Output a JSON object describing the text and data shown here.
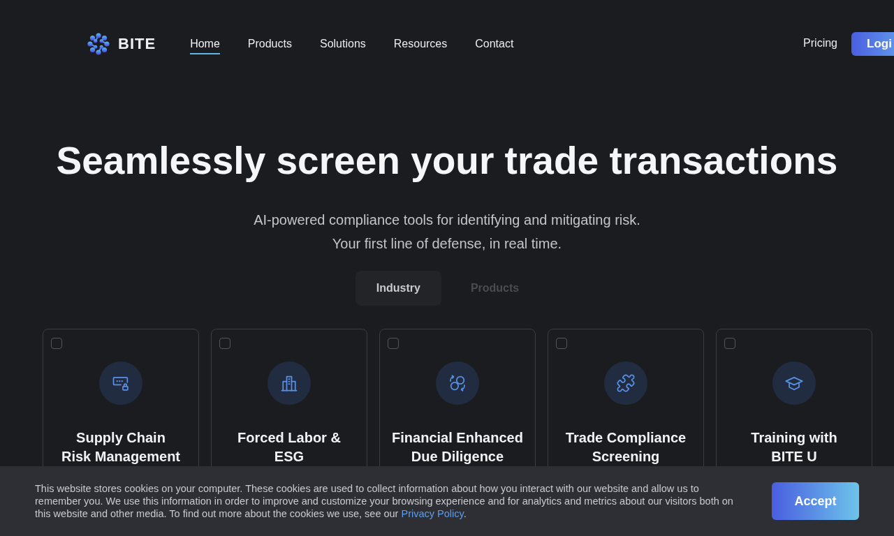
{
  "header": {
    "brand": "BITE",
    "nav": [
      {
        "label": "Home",
        "selected": true
      },
      {
        "label": "Products",
        "selected": false
      },
      {
        "label": "Solutions",
        "selected": false
      },
      {
        "label": "Resources",
        "selected": false
      },
      {
        "label": "Contact",
        "selected": false
      }
    ],
    "pricing_link": "Pricing",
    "login_button": "Logi"
  },
  "hero": {
    "title": "Seamlessly screen your trade transactions",
    "subtitle_lines": [
      "AI-powered compliance tools for identifying and mitigating risk.",
      "Your first line of defense, in real time."
    ],
    "tabs": [
      {
        "label": "Industry",
        "selected": true
      },
      {
        "label": "Products",
        "selected": false
      }
    ]
  },
  "cards": [
    {
      "title_lines": [
        "Supply Chain",
        "Risk Management"
      ],
      "checked": false
    },
    {
      "title_lines": [
        "Forced Labor &",
        "ESG"
      ],
      "checked": false
    },
    {
      "title_lines": [
        "Financial Enhanced",
        "Due Diligence"
      ],
      "checked": false
    },
    {
      "title_lines": [
        "Trade Compliance",
        "Screening"
      ],
      "checked": false
    },
    {
      "title_lines": [
        "Training with",
        "BITE U"
      ],
      "checked": false
    }
  ],
  "cookie_banner": {
    "text_before_link": "This website stores cookies on your computer. These cookies are used to collect information about how you interact with our website and allow us to remember you. We use this information in order to improve and customize your browsing experience and for analytics and metrics about our visitors both on this website and other media. To find out more about the cookies we use, see our ",
    "link": "Privacy Policy",
    "text_after_link": ".",
    "button": "Accept"
  }
}
